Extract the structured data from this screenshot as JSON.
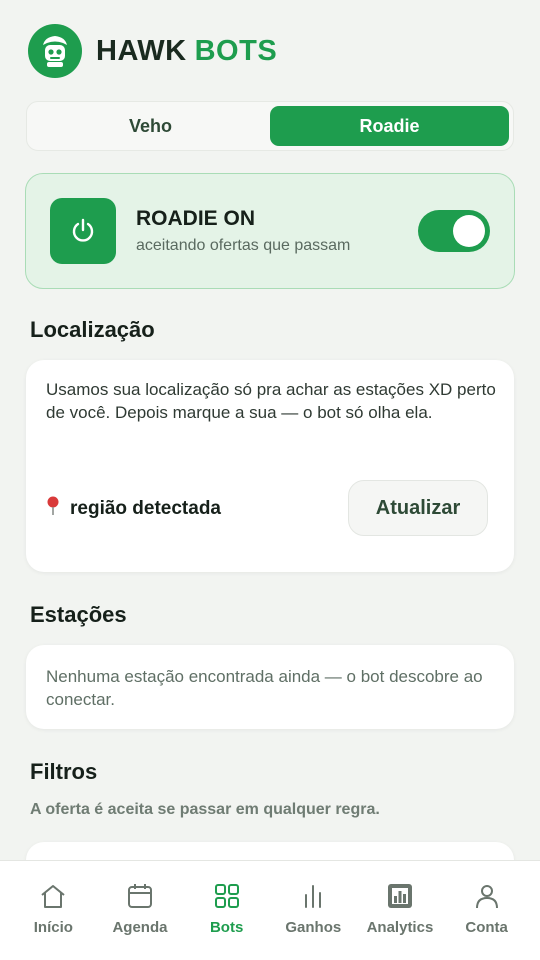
{
  "header": {
    "brand_primary": "HAWK",
    "brand_accent": "BOTS"
  },
  "segment": {
    "options": [
      {
        "label": "Veho",
        "active": false
      },
      {
        "label": "Roadie",
        "active": true
      }
    ]
  },
  "status": {
    "title": "ROADIE ON",
    "subtitle": "aceitando ofertas que passam",
    "enabled": true
  },
  "location": {
    "section_title": "Localização",
    "description": "Usamos sua localização só pra achar as estações XD perto de você. Depois marque a sua — o bot só olha ela.",
    "region_label": "região detectada",
    "update_label": "Atualizar"
  },
  "stations": {
    "section_title": "Estações",
    "empty_text": "Nenhuma estação encontrada ainda — o bot descobre ao conectar."
  },
  "filters": {
    "section_title": "Filtros",
    "subtitle": "A oferta é aceita se passar em qualquer regra."
  },
  "nav": {
    "items": [
      {
        "label": "Início",
        "icon": "home-icon",
        "active": false
      },
      {
        "label": "Agenda",
        "icon": "calendar-icon",
        "active": false
      },
      {
        "label": "Bots",
        "icon": "grid-icon",
        "active": true
      },
      {
        "label": "Ganhos",
        "icon": "bar-chart-icon",
        "active": false
      },
      {
        "label": "Analytics",
        "icon": "analytics-icon",
        "active": false
      },
      {
        "label": "Conta",
        "icon": "user-icon",
        "active": false
      }
    ]
  },
  "colors": {
    "accent": "#1e9d4e",
    "status_bg": "#e4f3e7",
    "background": "#f2f4f1"
  }
}
